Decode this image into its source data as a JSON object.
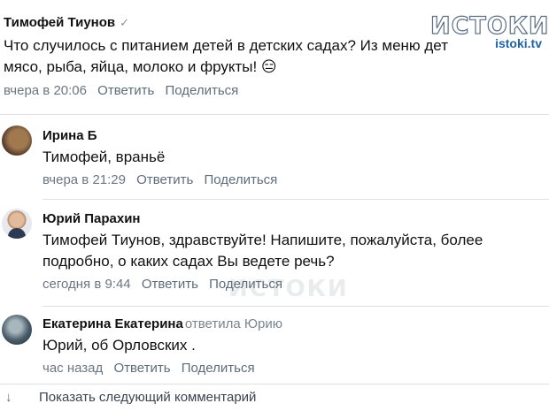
{
  "logo": {
    "main": "ИСТОКИ",
    "sub": "istoki.tv"
  },
  "comments": [
    {
      "author": "Тимофей Тиунов",
      "verified": "✓",
      "lines": [
        "Что случилось с питанием детей в детских садах? Из меню дет",
        "мясо, рыба, яйца, молоко и фрукты! 😑"
      ],
      "time": "вчера в 20:06",
      "reply": "Ответить",
      "share": "Поделиться"
    },
    {
      "author": "Ирина Б",
      "lines": [
        "Тимофей, враньё"
      ],
      "time": "вчера в 21:29",
      "reply": "Ответить",
      "share": "Поделиться"
    },
    {
      "author": "Юрий Парахин",
      "lines": [
        "Тимофей Тиунов, здравствуйте! Напишите, пожалуйста, более",
        "подробно, о каких садах Вы ведете речь?"
      ],
      "time": "сегодня в 9:44",
      "reply": "Ответить",
      "share": "Поделиться"
    },
    {
      "author": "Екатерина Екатерина",
      "replied_to": "ответила Юрию",
      "lines": [
        "Юрий, об Орловских ."
      ],
      "time": "час назад",
      "reply": "Ответить",
      "share": "Поделиться"
    }
  ],
  "more": {
    "icon": "arrow-down-icon",
    "label": "Показать следующий комментарий"
  },
  "watermark": "ИСТОКИ"
}
